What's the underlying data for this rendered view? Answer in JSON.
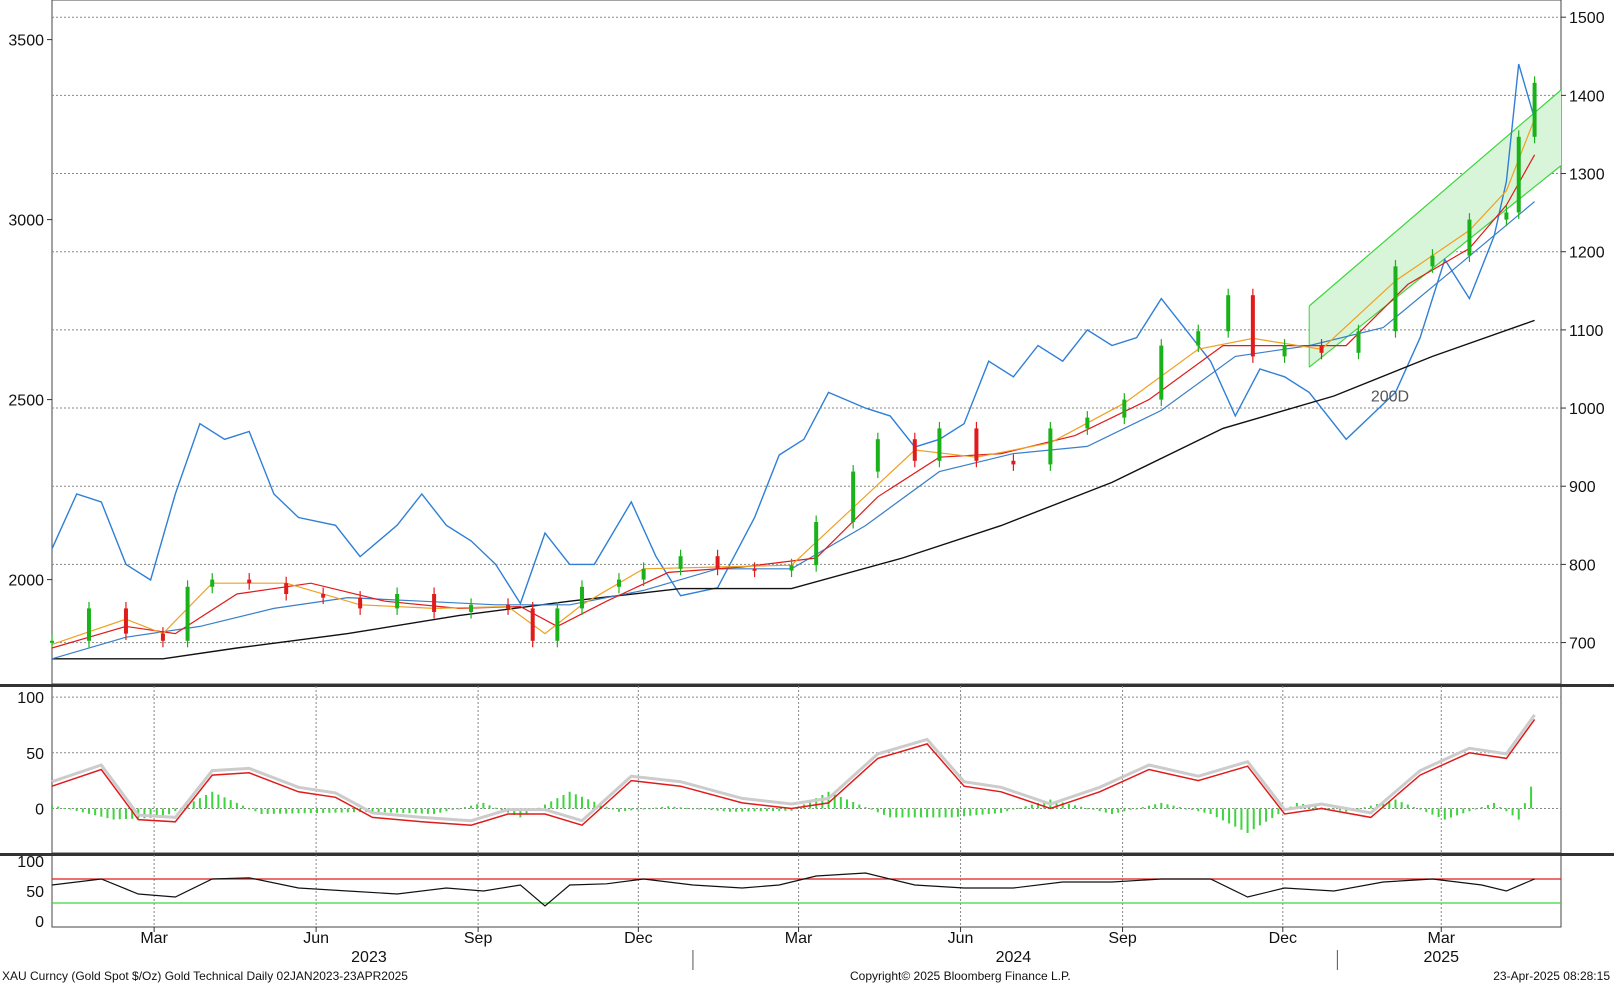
{
  "chart_data": {
    "type": "line",
    "instrument": "XAU Curncy (Gold Spot  $/Oz) Gold Technical  Daily 02JAN2023-23APR2025",
    "copyright": "Copyright© 2025 Bloomberg Finance L.P.",
    "timestamp": "23-Apr-2025 08:28:15",
    "annotation": "200D",
    "x_tick_labels": [
      "Mar",
      "Jun",
      "Sep",
      "Dec",
      "Mar",
      "Jun",
      "Sep",
      "Dec",
      "Mar"
    ],
    "x_tick_dates": [
      "2023-03-01",
      "2023-06-01",
      "2023-09-01",
      "2023-12-01",
      "2024-03-01",
      "2024-06-01",
      "2024-09-01",
      "2024-12-01",
      "2025-03-01"
    ],
    "year_labels": [
      {
        "label": "2023",
        "date": "2023-07-01"
      },
      {
        "label": "2024",
        "date": "2024-07-01"
      },
      {
        "label": "2025",
        "date": "2025-03-01"
      }
    ],
    "xlim": [
      "2023-01-02",
      "2025-05-08"
    ],
    "panels": [
      {
        "name": "price",
        "left_axis": {
          "ticks": [
            2000,
            2500,
            3000,
            3500
          ],
          "ylim": [
            1710,
            3610
          ]
        },
        "right_axis": {
          "ticks": [
            700,
            800,
            900,
            1000,
            1100,
            1200,
            1300,
            1400,
            1500
          ],
          "ylim": [
            647,
            1522
          ]
        },
        "gridlines_right": [
          700,
          800,
          900,
          1000,
          1100,
          1200,
          1300,
          1400,
          1500
        ],
        "series": [
          {
            "role": "gold-spot-ohlc-candles",
            "color_up": "#19b319",
            "color_down": "#e01b1b",
            "axis": "left",
            "dates": [
              "2023-01-02",
              "2023-01-23",
              "2023-02-13",
              "2023-03-06",
              "2023-03-20",
              "2023-04-03",
              "2023-04-24",
              "2023-05-15",
              "2023-06-05",
              "2023-06-26",
              "2023-07-17",
              "2023-08-07",
              "2023-08-28",
              "2023-09-18",
              "2023-10-02",
              "2023-10-16",
              "2023-10-30",
              "2023-11-20",
              "2023-12-04",
              "2023-12-25",
              "2024-01-15",
              "2024-02-05",
              "2024-02-26",
              "2024-03-11",
              "2024-04-01",
              "2024-04-15",
              "2024-05-06",
              "2024-05-20",
              "2024-06-10",
              "2024-07-01",
              "2024-07-22",
              "2024-08-12",
              "2024-09-02",
              "2024-09-23",
              "2024-10-14",
              "2024-10-31",
              "2024-11-14",
              "2024-12-02",
              "2024-12-23",
              "2025-01-13",
              "2025-02-03",
              "2025-02-24",
              "2025-03-17",
              "2025-04-07",
              "2025-04-14",
              "2025-04-23"
            ],
            "values": [
              1830,
              1920,
              1850,
              1830,
              1980,
              2000,
              1990,
              1960,
              1950,
              1920,
              1960,
              1910,
              1930,
              1920,
              1830,
              1920,
              1980,
              2000,
              2030,
              2065,
              2030,
              2025,
              2040,
              2160,
              2300,
              2390,
              2330,
              2420,
              2330,
              2320,
              2420,
              2450,
              2500,
              2650,
              2690,
              2790,
              2620,
              2650,
              2630,
              2690,
              2870,
              2900,
              3000,
              3020,
              3230,
              3380
            ]
          },
          {
            "role": "moving-average-orange",
            "color": "#f0a020",
            "axis": "left",
            "dates": [
              "2023-01-02",
              "2023-02-13",
              "2023-03-06",
              "2023-04-03",
              "2023-05-15",
              "2023-06-26",
              "2023-08-07",
              "2023-09-18",
              "2023-10-09",
              "2023-10-30",
              "2023-12-04",
              "2024-01-15",
              "2024-02-26",
              "2024-04-01",
              "2024-05-06",
              "2024-06-10",
              "2024-07-22",
              "2024-09-02",
              "2024-10-14",
              "2024-11-14",
              "2024-12-23",
              "2025-02-03",
              "2025-03-17",
              "2025-04-07",
              "2025-04-23"
            ],
            "values": [
              1820,
              1890,
              1850,
              1990,
              1990,
              1930,
              1920,
              1925,
              1850,
              1930,
              2030,
              2035,
              2040,
              2200,
              2360,
              2340,
              2380,
              2490,
              2640,
              2670,
              2640,
              2830,
              2970,
              3080,
              3280
            ]
          },
          {
            "role": "moving-average-red",
            "color": "#e01b1b",
            "axis": "left",
            "dates": [
              "2023-01-02",
              "2023-02-13",
              "2023-03-13",
              "2023-04-17",
              "2023-05-29",
              "2023-07-10",
              "2023-08-21",
              "2023-09-25",
              "2023-10-16",
              "2023-11-13",
              "2023-12-18",
              "2024-01-29",
              "2024-03-11",
              "2024-04-15",
              "2024-05-20",
              "2024-06-24",
              "2024-08-05",
              "2024-09-16",
              "2024-10-28",
              "2024-11-25",
              "2025-01-06",
              "2025-02-10",
              "2025-03-17",
              "2025-04-07",
              "2025-04-23"
            ],
            "values": [
              1810,
              1870,
              1850,
              1960,
              1990,
              1940,
              1920,
              1925,
              1870,
              1940,
              2020,
              2035,
              2060,
              2230,
              2340,
              2350,
              2400,
              2500,
              2650,
              2650,
              2650,
              2820,
              2920,
              3040,
              3180
            ]
          },
          {
            "role": "moving-average-blue",
            "color": "#3a7fc8",
            "axis": "left",
            "dates": [
              "2023-01-02",
              "2023-02-13",
              "2023-03-27",
              "2023-05-08",
              "2023-06-19",
              "2023-07-31",
              "2023-09-11",
              "2023-10-23",
              "2023-12-04",
              "2024-01-15",
              "2024-02-26",
              "2024-04-08",
              "2024-05-20",
              "2024-07-01",
              "2024-08-12",
              "2024-09-23",
              "2024-11-04",
              "2024-12-16",
              "2025-01-27",
              "2025-03-10",
              "2025-04-23"
            ],
            "values": [
              1780,
              1840,
              1870,
              1920,
              1950,
              1940,
              1930,
              1930,
              1970,
              2030,
              2030,
              2150,
              2300,
              2350,
              2370,
              2470,
              2620,
              2650,
              2700,
              2870,
              3050
            ]
          },
          {
            "role": "moving-average-200d",
            "color": "#111111",
            "axis": "left",
            "dates": [
              "2023-01-02",
              "2023-03-06",
              "2023-04-17",
              "2023-06-19",
              "2023-08-21",
              "2023-10-23",
              "2023-12-25",
              "2024-02-26",
              "2024-04-29",
              "2024-06-24",
              "2024-08-26",
              "2024-10-28",
              "2024-12-30",
              "2025-02-24",
              "2025-04-23"
            ],
            "values": [
              1780,
              1780,
              1810,
              1850,
              1900,
              1940,
              1975,
              1975,
              2060,
              2150,
              2270,
              2420,
              2510,
              2620,
              2720
            ]
          },
          {
            "role": "secondary-series-blue",
            "color": "#2f7fd6",
            "axis": "right",
            "dates": [
              "2023-01-02",
              "2023-01-16",
              "2023-01-30",
              "2023-02-13",
              "2023-02-27",
              "2023-03-13",
              "2023-03-27",
              "2023-04-10",
              "2023-04-24",
              "2023-05-08",
              "2023-05-22",
              "2023-06-12",
              "2023-06-26",
              "2023-07-17",
              "2023-07-31",
              "2023-08-14",
              "2023-08-28",
              "2023-09-11",
              "2023-09-25",
              "2023-10-09",
              "2023-10-23",
              "2023-11-06",
              "2023-11-27",
              "2023-12-11",
              "2023-12-25",
              "2024-01-15",
              "2024-02-05",
              "2024-02-19",
              "2024-03-04",
              "2024-03-18",
              "2024-04-08",
              "2024-04-22",
              "2024-05-06",
              "2024-05-20",
              "2024-06-03",
              "2024-06-17",
              "2024-07-01",
              "2024-07-15",
              "2024-07-29",
              "2024-08-12",
              "2024-08-26",
              "2024-09-09",
              "2024-09-23",
              "2024-10-07",
              "2024-10-21",
              "2024-11-04",
              "2024-11-18",
              "2024-12-02",
              "2024-12-16",
              "2025-01-06",
              "2025-01-20",
              "2025-02-03",
              "2025-02-17",
              "2025-03-03",
              "2025-03-17",
              "2025-03-31",
              "2025-04-07",
              "2025-04-14",
              "2025-04-23"
            ],
            "values": [
              820,
              890,
              880,
              800,
              780,
              890,
              980,
              960,
              970,
              890,
              860,
              850,
              810,
              850,
              890,
              850,
              830,
              800,
              750,
              840,
              800,
              800,
              880,
              810,
              760,
              770,
              860,
              940,
              960,
              1020,
              1000,
              990,
              950,
              960,
              980,
              1060,
              1040,
              1080,
              1060,
              1100,
              1080,
              1090,
              1140,
              1100,
              1060,
              990,
              1050,
              1040,
              1020,
              960,
              990,
              1020,
              1090,
              1190,
              1140,
              1220,
              1290,
              1440,
              1370
            ]
          }
        ],
        "channel": {
          "color": "#3cd63c",
          "fill": "#d9f5d9",
          "upper_start": [
            "2024-12-16",
            2760
          ],
          "upper_end": [
            "2025-05-08",
            3360
          ],
          "lower_start": [
            "2024-12-16",
            2590
          ],
          "lower_end": [
            "2025-05-08",
            3150
          ]
        }
      },
      {
        "name": "momentum",
        "ticks": [
          0,
          50,
          100
        ],
        "ylim": [
          -40,
          110
        ],
        "series": [
          {
            "role": "signal-line",
            "color": "#e01b1b",
            "dates": [
              "2023-01-02",
              "2023-01-30",
              "2023-02-20",
              "2023-03-13",
              "2023-04-03",
              "2023-04-24",
              "2023-05-22",
              "2023-06-12",
              "2023-07-03",
              "2023-07-31",
              "2023-08-28",
              "2023-09-18",
              "2023-10-09",
              "2023-10-30",
              "2023-11-27",
              "2023-12-25",
              "2024-01-29",
              "2024-02-26",
              "2024-03-18",
              "2024-04-15",
              "2024-05-13",
              "2024-06-03",
              "2024-06-24",
              "2024-07-22",
              "2024-08-19",
              "2024-09-16",
              "2024-10-14",
              "2024-11-11",
              "2024-12-02",
              "2024-12-23",
              "2025-01-20",
              "2025-02-17",
              "2025-03-17",
              "2025-04-07",
              "2025-04-23"
            ],
            "values": [
              20,
              35,
              -10,
              -12,
              30,
              32,
              15,
              10,
              -8,
              -12,
              -15,
              -5,
              -5,
              -15,
              25,
              20,
              5,
              0,
              5,
              45,
              58,
              20,
              15,
              0,
              15,
              35,
              25,
              38,
              -5,
              0,
              -8,
              30,
              50,
              45,
              80
            ]
          },
          {
            "role": "histogram",
            "color": "#3cd63c",
            "dates": [
              "2023-01-02",
              "2023-02-06",
              "2023-03-06",
              "2023-04-03",
              "2023-05-01",
              "2023-06-05",
              "2023-07-03",
              "2023-08-07",
              "2023-09-04",
              "2023-09-25",
              "2023-10-23",
              "2023-11-20",
              "2023-12-18",
              "2024-01-22",
              "2024-02-26",
              "2024-03-18",
              "2024-04-22",
              "2024-05-27",
              "2024-06-24",
              "2024-07-22",
              "2024-08-26",
              "2024-09-23",
              "2024-10-21",
              "2024-11-11",
              "2024-12-09",
              "2025-01-06",
              "2025-02-03",
              "2025-03-03",
              "2025-03-31",
              "2025-04-14",
              "2025-04-23"
            ],
            "values": [
              3,
              -10,
              -8,
              15,
              -5,
              -4,
              -3,
              -5,
              5,
              -8,
              15,
              -3,
              2,
              -3,
              -2,
              15,
              -8,
              -8,
              -4,
              8,
              -5,
              5,
              -5,
              -22,
              5,
              -3,
              8,
              -10,
              5,
              -10,
              28
            ]
          }
        ]
      },
      {
        "name": "rsi",
        "ticks": [
          0,
          50,
          100
        ],
        "ylim": [
          -10,
          110
        ],
        "levels": [
          {
            "value": 70,
            "color": "#e01b1b"
          },
          {
            "value": 30,
            "color": "#3cd63c"
          }
        ],
        "series": [
          {
            "role": "rsi-line",
            "color": "#111111",
            "dates": [
              "2023-01-02",
              "2023-01-30",
              "2023-02-20",
              "2023-03-13",
              "2023-04-03",
              "2023-04-24",
              "2023-05-22",
              "2023-06-19",
              "2023-07-17",
              "2023-08-14",
              "2023-09-04",
              "2023-09-25",
              "2023-10-09",
              "2023-10-23",
              "2023-11-13",
              "2023-12-04",
              "2024-01-01",
              "2024-01-29",
              "2024-02-19",
              "2024-03-11",
              "2024-04-08",
              "2024-05-06",
              "2024-06-03",
              "2024-07-01",
              "2024-07-29",
              "2024-08-26",
              "2024-09-23",
              "2024-10-21",
              "2024-11-11",
              "2024-12-02",
              "2024-12-30",
              "2025-01-27",
              "2025-02-24",
              "2025-03-24",
              "2025-04-07",
              "2025-04-23"
            ],
            "values": [
              60,
              70,
              45,
              40,
              70,
              72,
              55,
              50,
              45,
              55,
              50,
              60,
              25,
              60,
              62,
              70,
              60,
              55,
              60,
              75,
              80,
              60,
              55,
              55,
              65,
              65,
              70,
              70,
              40,
              55,
              50,
              65,
              70,
              60,
              50,
              70
            ]
          }
        ]
      }
    ]
  }
}
